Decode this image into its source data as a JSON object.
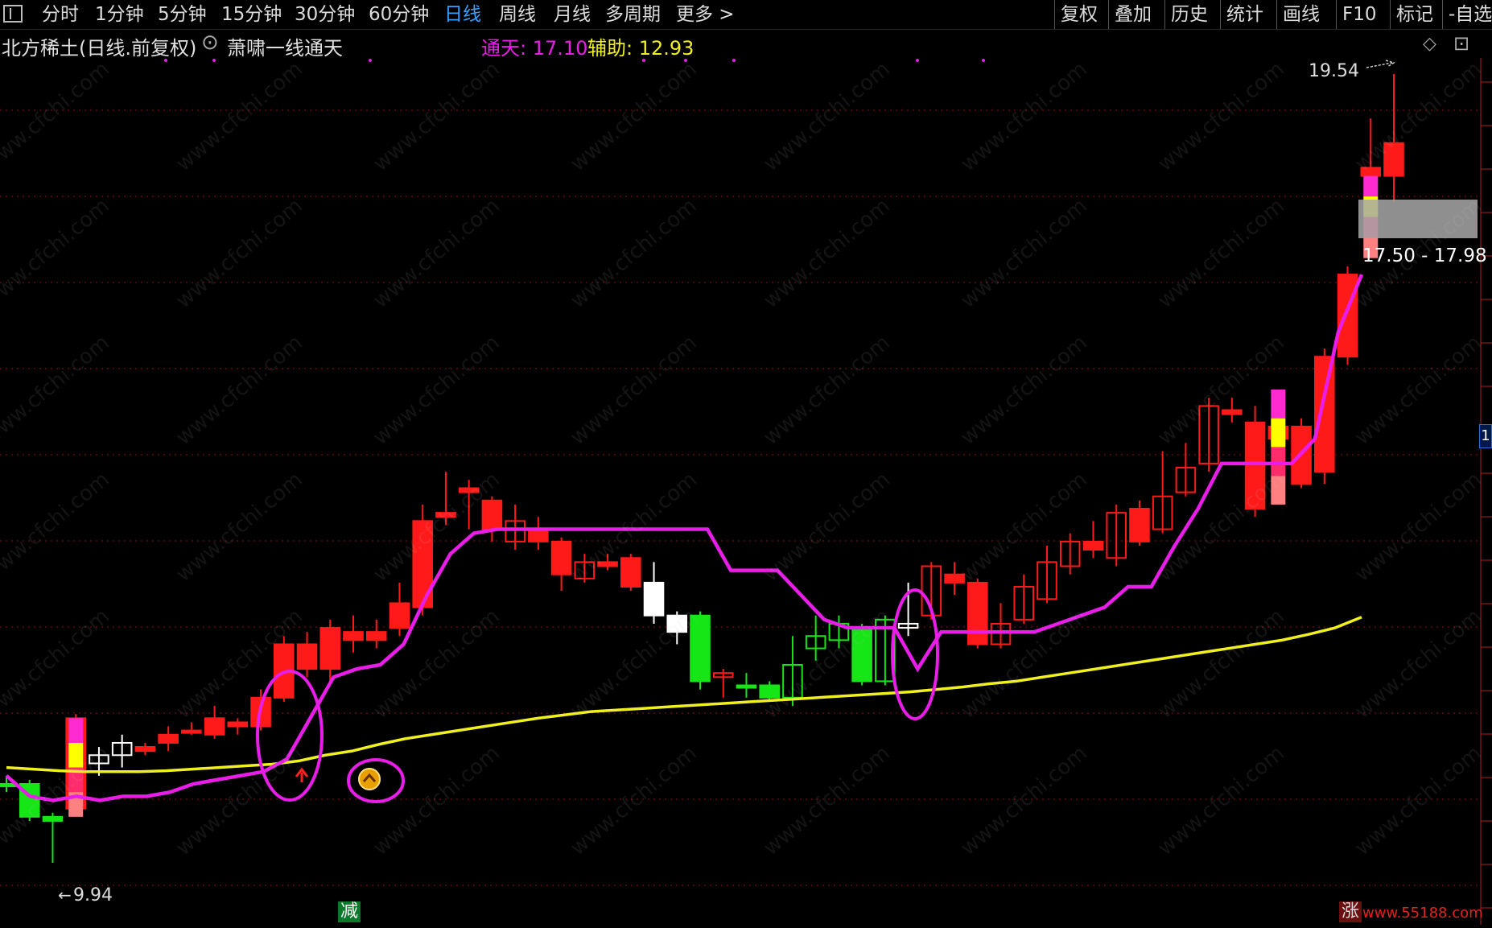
{
  "toolbar": {
    "periods": [
      {
        "label": "分时"
      },
      {
        "label": "1分钟"
      },
      {
        "label": "5分钟"
      },
      {
        "label": "15分钟"
      },
      {
        "label": "30分钟"
      },
      {
        "label": "60分钟"
      },
      {
        "label": "日线"
      },
      {
        "label": "周线"
      },
      {
        "label": "月线"
      },
      {
        "label": "多周期"
      },
      {
        "label": "更多 >"
      }
    ],
    "active_period": "日线",
    "actions": [
      {
        "label": "复权"
      },
      {
        "label": "叠加"
      },
      {
        "label": "历史"
      },
      {
        "label": "统计"
      },
      {
        "label": "画线"
      },
      {
        "label": "F10"
      },
      {
        "label": "标记"
      },
      {
        "label": "-自选"
      }
    ]
  },
  "info": {
    "stock": "北方稀土(日线.前复权)",
    "indicator": "萧啸一线通天",
    "tongtian_label": "通天: 17.10",
    "fuzhu_label": "辅助: 12.93"
  },
  "colors": {
    "background": "#000000",
    "up": "#ff1a1a",
    "down": "#16e616",
    "tongtian_line": "#e81ee8",
    "fuzhu_line": "#f0f020",
    "grid": "#8b1010"
  },
  "annotations": {
    "high_label": "19.54",
    "low_label": "9.94",
    "zone_label": "17.50 - 17.98",
    "right_axis_tag": "1",
    "bottom_tag_jian": "减",
    "bottom_tag_zhang": "涨",
    "site": "www.55188.com",
    "watermark": "www.cfchi.com"
  },
  "chart_data": {
    "type": "candlestick",
    "title": "北方稀土(日线.前复权)",
    "y_reference": {
      "high": 19.54,
      "low": 9.94
    },
    "indicators": [
      {
        "name": "通天",
        "last": 17.1
      },
      {
        "name": "辅助",
        "last": 12.93
      }
    ],
    "candles": [
      {
        "o": 10.9,
        "c": 10.9,
        "h": 11.0,
        "l": 10.8,
        "dir": "flat"
      },
      {
        "o": 10.9,
        "c": 10.5,
        "h": 10.95,
        "l": 10.45,
        "dir": "down"
      },
      {
        "o": 10.45,
        "c": 10.5,
        "h": 10.55,
        "l": 9.94,
        "dir": "down"
      },
      {
        "o": 10.6,
        "c": 11.7,
        "h": 11.75,
        "l": 10.55,
        "dir": "up"
      },
      {
        "o": 11.15,
        "c": 11.25,
        "h": 11.35,
        "l": 11.0,
        "dir": "up_hollow_w"
      },
      {
        "o": 11.25,
        "c": 11.4,
        "h": 11.5,
        "l": 11.1,
        "dir": "up_hollow_w"
      },
      {
        "o": 11.35,
        "c": 11.3,
        "h": 11.4,
        "l": 11.25,
        "dir": "up"
      },
      {
        "o": 11.4,
        "c": 11.5,
        "h": 11.6,
        "l": 11.3,
        "dir": "up"
      },
      {
        "o": 11.55,
        "c": 11.55,
        "h": 11.65,
        "l": 11.5,
        "dir": "up"
      },
      {
        "o": 11.5,
        "c": 11.7,
        "h": 11.85,
        "l": 11.45,
        "dir": "up"
      },
      {
        "o": 11.65,
        "c": 11.6,
        "h": 11.7,
        "l": 11.5,
        "dir": "up"
      },
      {
        "o": 11.6,
        "c": 11.95,
        "h": 12.05,
        "l": 11.55,
        "dir": "up"
      },
      {
        "o": 11.95,
        "c": 12.6,
        "h": 12.7,
        "l": 11.9,
        "dir": "up"
      },
      {
        "o": 12.6,
        "c": 12.3,
        "h": 12.75,
        "l": 12.2,
        "dir": "up"
      },
      {
        "o": 12.3,
        "c": 12.8,
        "h": 12.9,
        "l": 12.15,
        "dir": "up"
      },
      {
        "o": 12.75,
        "c": 12.65,
        "h": 12.95,
        "l": 12.5,
        "dir": "up"
      },
      {
        "o": 12.65,
        "c": 12.75,
        "h": 12.9,
        "l": 12.55,
        "dir": "up"
      },
      {
        "o": 12.8,
        "c": 13.1,
        "h": 13.35,
        "l": 12.7,
        "dir": "up"
      },
      {
        "o": 13.05,
        "c": 14.1,
        "h": 14.3,
        "l": 12.95,
        "dir": "up"
      },
      {
        "o": 14.15,
        "c": 14.2,
        "h": 14.7,
        "l": 14.05,
        "dir": "up"
      },
      {
        "o": 14.5,
        "c": 14.45,
        "h": 14.6,
        "l": 14.0,
        "dir": "up"
      },
      {
        "o": 14.35,
        "c": 14.0,
        "h": 14.4,
        "l": 13.85,
        "dir": "up"
      },
      {
        "o": 13.85,
        "c": 14.1,
        "h": 14.3,
        "l": 13.75,
        "dir": "up_hollow"
      },
      {
        "o": 14.0,
        "c": 13.85,
        "h": 14.15,
        "l": 13.75,
        "dir": "up"
      },
      {
        "o": 13.85,
        "c": 13.45,
        "h": 13.9,
        "l": 13.25,
        "dir": "up"
      },
      {
        "o": 13.4,
        "c": 13.6,
        "h": 13.7,
        "l": 13.35,
        "dir": "up_hollow"
      },
      {
        "o": 13.55,
        "c": 13.6,
        "h": 13.7,
        "l": 13.5,
        "dir": "up"
      },
      {
        "o": 13.65,
        "c": 13.3,
        "h": 13.7,
        "l": 13.25,
        "dir": "up"
      },
      {
        "o": 13.35,
        "c": 12.95,
        "h": 13.6,
        "l": 12.85,
        "dir": "down_w"
      },
      {
        "o": 12.95,
        "c": 12.75,
        "h": 13.0,
        "l": 12.6,
        "dir": "down_w"
      },
      {
        "o": 12.95,
        "c": 12.15,
        "h": 13.0,
        "l": 12.05,
        "dir": "down"
      },
      {
        "o": 12.2,
        "c": 12.25,
        "h": 12.3,
        "l": 11.95,
        "dir": "up_hollow"
      },
      {
        "o": 12.1,
        "c": 12.1,
        "h": 12.25,
        "l": 11.95,
        "dir": "down"
      },
      {
        "o": 12.1,
        "c": 11.95,
        "h": 12.15,
        "l": 11.9,
        "dir": "down"
      },
      {
        "o": 11.95,
        "c": 12.35,
        "h": 12.7,
        "l": 11.85,
        "dir": "up_hollow_g"
      },
      {
        "o": 12.55,
        "c": 12.7,
        "h": 12.95,
        "l": 12.4,
        "dir": "up_hollow_g"
      },
      {
        "o": 12.65,
        "c": 12.85,
        "h": 12.95,
        "l": 12.55,
        "dir": "up_hollow_g"
      },
      {
        "o": 12.8,
        "c": 12.15,
        "h": 12.85,
        "l": 12.1,
        "dir": "down"
      },
      {
        "o": 12.15,
        "c": 12.9,
        "h": 12.95,
        "l": 12.1,
        "dir": "up_hollow_g"
      },
      {
        "o": 12.8,
        "c": 12.85,
        "h": 13.35,
        "l": 12.7,
        "dir": "up_hollow_w"
      },
      {
        "o": 12.95,
        "c": 13.55,
        "h": 13.6,
        "l": 12.9,
        "dir": "up_hollow"
      },
      {
        "o": 13.45,
        "c": 13.35,
        "h": 13.6,
        "l": 13.2,
        "dir": "up"
      },
      {
        "o": 13.35,
        "c": 12.6,
        "h": 13.4,
        "l": 12.55,
        "dir": "up"
      },
      {
        "o": 12.6,
        "c": 12.85,
        "h": 13.1,
        "l": 12.55,
        "dir": "up_hollow"
      },
      {
        "o": 12.9,
        "c": 13.3,
        "h": 13.45,
        "l": 12.85,
        "dir": "up_hollow"
      },
      {
        "o": 13.15,
        "c": 13.6,
        "h": 13.8,
        "l": 13.1,
        "dir": "up_hollow"
      },
      {
        "o": 13.55,
        "c": 13.85,
        "h": 13.95,
        "l": 13.45,
        "dir": "up_hollow"
      },
      {
        "o": 13.75,
        "c": 13.85,
        "h": 14.1,
        "l": 13.65,
        "dir": "up"
      },
      {
        "o": 13.65,
        "c": 14.2,
        "h": 14.3,
        "l": 13.55,
        "dir": "up_hollow"
      },
      {
        "o": 13.85,
        "c": 14.25,
        "h": 14.35,
        "l": 13.8,
        "dir": "up"
      },
      {
        "o": 14.0,
        "c": 14.4,
        "h": 14.95,
        "l": 13.95,
        "dir": "up_hollow"
      },
      {
        "o": 14.45,
        "c": 14.75,
        "h": 15.05,
        "l": 14.4,
        "dir": "up_hollow"
      },
      {
        "o": 14.8,
        "c": 15.5,
        "h": 15.6,
        "l": 14.7,
        "dir": "up_hollow"
      },
      {
        "o": 15.45,
        "c": 15.4,
        "h": 15.6,
        "l": 15.3,
        "dir": "up"
      },
      {
        "o": 15.3,
        "c": 14.25,
        "h": 15.5,
        "l": 14.15,
        "dir": "up"
      },
      {
        "o": 15.25,
        "c": 15.1,
        "h": 15.35,
        "l": 15.05,
        "dir": "up"
      },
      {
        "o": 15.25,
        "c": 14.55,
        "h": 15.35,
        "l": 14.5,
        "dir": "up"
      },
      {
        "o": 14.7,
        "c": 16.1,
        "h": 16.2,
        "l": 14.55,
        "dir": "up"
      },
      {
        "o": 16.1,
        "c": 17.1,
        "h": 17.2,
        "l": 16.0,
        "dir": "up"
      },
      {
        "o": 18.4,
        "c": 18.3,
        "h": 19.0,
        "l": 18.1,
        "dir": "up"
      },
      {
        "o": 18.3,
        "c": 18.7,
        "h": 19.54,
        "l": 17.98,
        "dir": "up"
      }
    ],
    "tongtian_line": [
      11.0,
      10.75,
      10.7,
      10.75,
      10.7,
      10.75,
      10.75,
      10.8,
      10.9,
      10.95,
      11.0,
      11.05,
      11.2,
      11.7,
      12.2,
      12.3,
      12.35,
      12.6,
      13.2,
      13.7,
      13.95,
      14.0,
      14.0,
      14.0,
      14.0,
      14.0,
      14.0,
      14.0,
      14.0,
      14.0,
      14.0,
      13.5,
      13.5,
      13.5,
      13.2,
      12.9,
      12.8,
      12.8,
      12.8,
      12.3,
      12.75,
      12.75,
      12.75,
      12.75,
      12.75,
      12.85,
      12.95,
      13.05,
      13.3,
      13.3,
      13.8,
      14.25,
      14.8,
      14.8,
      14.8,
      14.8,
      15.1,
      16.4,
      17.1
    ],
    "fuzhu_line": [
      11.1,
      11.08,
      11.06,
      11.05,
      11.05,
      11.05,
      11.06,
      11.08,
      11.1,
      11.12,
      11.14,
      11.18,
      11.25,
      11.3,
      11.38,
      11.45,
      11.5,
      11.55,
      11.6,
      11.65,
      11.7,
      11.74,
      11.78,
      11.8,
      11.82,
      11.84,
      11.86,
      11.88,
      11.9,
      11.92,
      11.94,
      11.96,
      11.98,
      12.0,
      12.02,
      12.05,
      12.08,
      12.12,
      12.15,
      12.2,
      12.25,
      12.3,
      12.35,
      12.4,
      12.45,
      12.5,
      12.55,
      12.6,
      12.65,
      12.72,
      12.8,
      12.93
    ]
  }
}
